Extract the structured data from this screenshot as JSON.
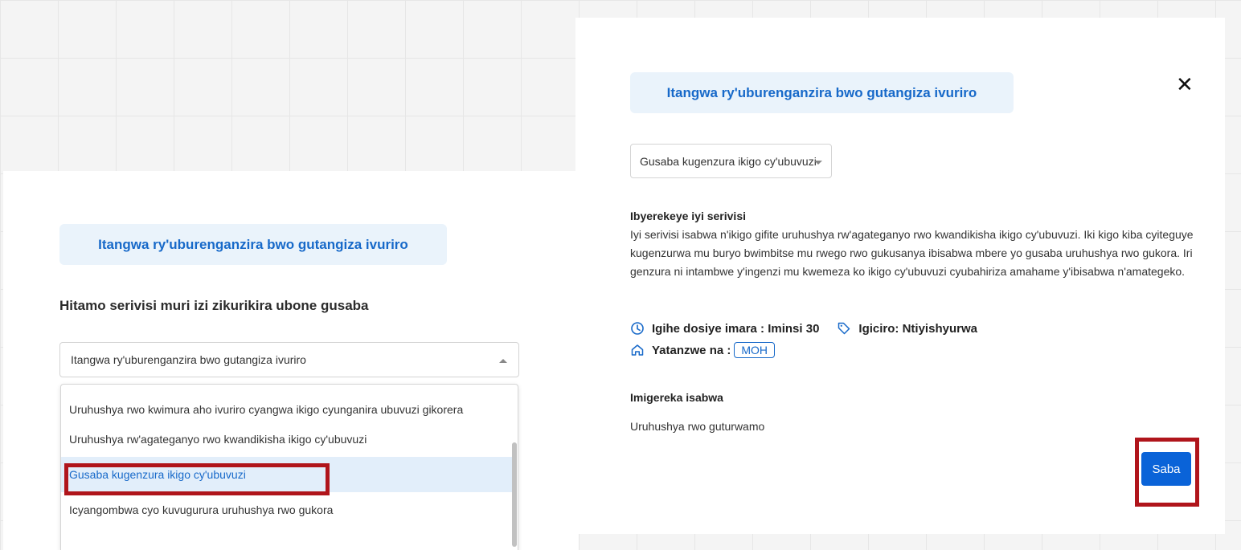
{
  "left_panel": {
    "title": "Itangwa ry'uburenganzira bwo gutangiza ivuriro",
    "prompt": "Hitamo serivisi muri izi zikurikira ubone gusaba",
    "select_value": "Itangwa ry'uburenganzira bwo gutangiza ivuriro",
    "options": [
      "Uruhushya rwo kwimura aho ivuriro cyangwa ikigo cyunganira ubuvuzi gikorera",
      "Uruhushya rw'agateganyo rwo kwandikisha ikigo cy'ubuvuzi",
      "Gusaba kugenzura ikigo cy'ubuvuzi",
      "Icyangombwa cyo kuvugurura uruhushya rwo gukora"
    ],
    "selected_option_index": 2
  },
  "right_panel": {
    "title": "Itangwa ry'uburenganzira bwo gutangiza ivuriro",
    "close_glyph": "✕",
    "select_value": "Gusaba kugenzura ikigo cy'ubuvuzi",
    "about_heading": "Ibyerekeye iyi serivisi",
    "about_body": "Iyi serivisi isabwa n'ikigo gifite uruhushya rw'agateganyo rwo kwandikisha ikigo cy'ubuvuzi. Iki kigo kiba cyiteguye kugenzurwa mu buryo bwimbitse mu rwego rwo gukusanya ibisabwa mbere yo gusaba uruhushya rwo gukora. Iri genzura ni intambwe y'ingenzi mu kwemeza ko ikigo cy'ubuvuzi cyubahiriza amahame y'ibisabwa n'amategeko.",
    "duration_label": "Igihe dosiye imara : Iminsi 30",
    "price_label": "Igiciro: Ntiyishyurwa",
    "provided_by_label": "Yatanzwe na :",
    "provider": "MOH",
    "docs_heading": "Imigereka isabwa",
    "docs": [
      "Uruhushya rwo guturwamo"
    ],
    "submit_label": "Saba"
  },
  "colors": {
    "accent": "#1769c9",
    "button": "#0a63d8",
    "highlight": "#b0151b",
    "pill_bg": "#eaf3fb"
  }
}
